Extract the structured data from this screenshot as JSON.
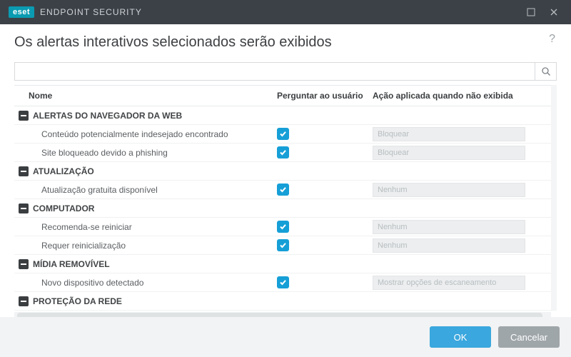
{
  "brand": {
    "badge": "eset",
    "product": "ENDPOINT SECURITY"
  },
  "page_title": "Os alertas interativos selecionados serão exibidos",
  "help_tooltip": "?",
  "search": {
    "value": ""
  },
  "columns": {
    "name": "Nome",
    "ask": "Perguntar ao usuário",
    "action": "Ação aplicada quando não exibida"
  },
  "groups": [
    {
      "label": "ALERTAS DO NAVEGADOR DA WEB",
      "items": [
        {
          "label": "Conteúdo potencialmente indesejado encontrado",
          "ask": true,
          "action": "Bloquear"
        },
        {
          "label": "Site bloqueado devido a phishing",
          "ask": true,
          "action": "Bloquear"
        }
      ]
    },
    {
      "label": "ATUALIZAÇÃO",
      "items": [
        {
          "label": "Atualização gratuita disponível",
          "ask": true,
          "action": "Nenhum"
        }
      ]
    },
    {
      "label": "COMPUTADOR",
      "items": [
        {
          "label": "Recomenda-se reiniciar",
          "ask": true,
          "action": "Nenhum"
        },
        {
          "label": "Requer reinicialização",
          "ask": true,
          "action": "Nenhum"
        }
      ]
    },
    {
      "label": "MÍDIA REMOVÍVEL",
      "items": [
        {
          "label": "Novo dispositivo detectado",
          "ask": true,
          "action": "Mostrar opções de escaneamento"
        }
      ]
    },
    {
      "label": "PROTEÇÃO DA REDE",
      "items": []
    }
  ],
  "buttons": {
    "ok": "OK",
    "cancel": "Cancelar"
  }
}
